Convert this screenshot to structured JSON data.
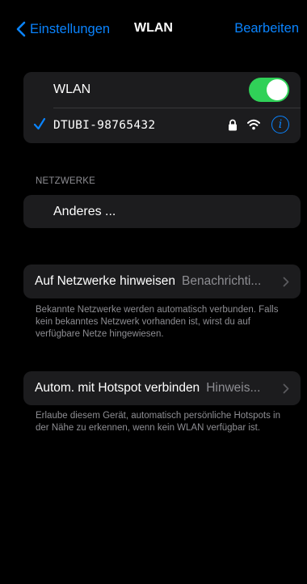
{
  "nav": {
    "back_label": "Einstellungen",
    "title": "WLAN",
    "edit_label": "Bearbeiten"
  },
  "wlan": {
    "label": "WLAN",
    "enabled": true,
    "connected_network": "DTUBI-98765432",
    "info_glyph": "i"
  },
  "networks": {
    "header": "NETZWERKE",
    "other_label": "Anderes ..."
  },
  "ask_join": {
    "label": "Auf Netzwerke hinweisen",
    "value": "Benachrichti...",
    "footer": "Bekannte Netzwerke werden automatisch verbunden. Falls kein bekanntes Netzwerk vorhanden ist, wirst du auf verfügbare Netze hingewiesen."
  },
  "auto_hotspot": {
    "label": "Autom. mit Hotspot verbinden",
    "value": "Hinweis...",
    "footer": "Erlaube diesem Gerät, automatisch persönliche Hotspots in der Nähe zu erkennen, wenn kein WLAN verfügbar ist."
  },
  "colors": {
    "accent": "#0a84ff",
    "toggle_on": "#30d158",
    "cell_bg": "#1c1c1e",
    "secondary_text": "#8e8e93"
  }
}
